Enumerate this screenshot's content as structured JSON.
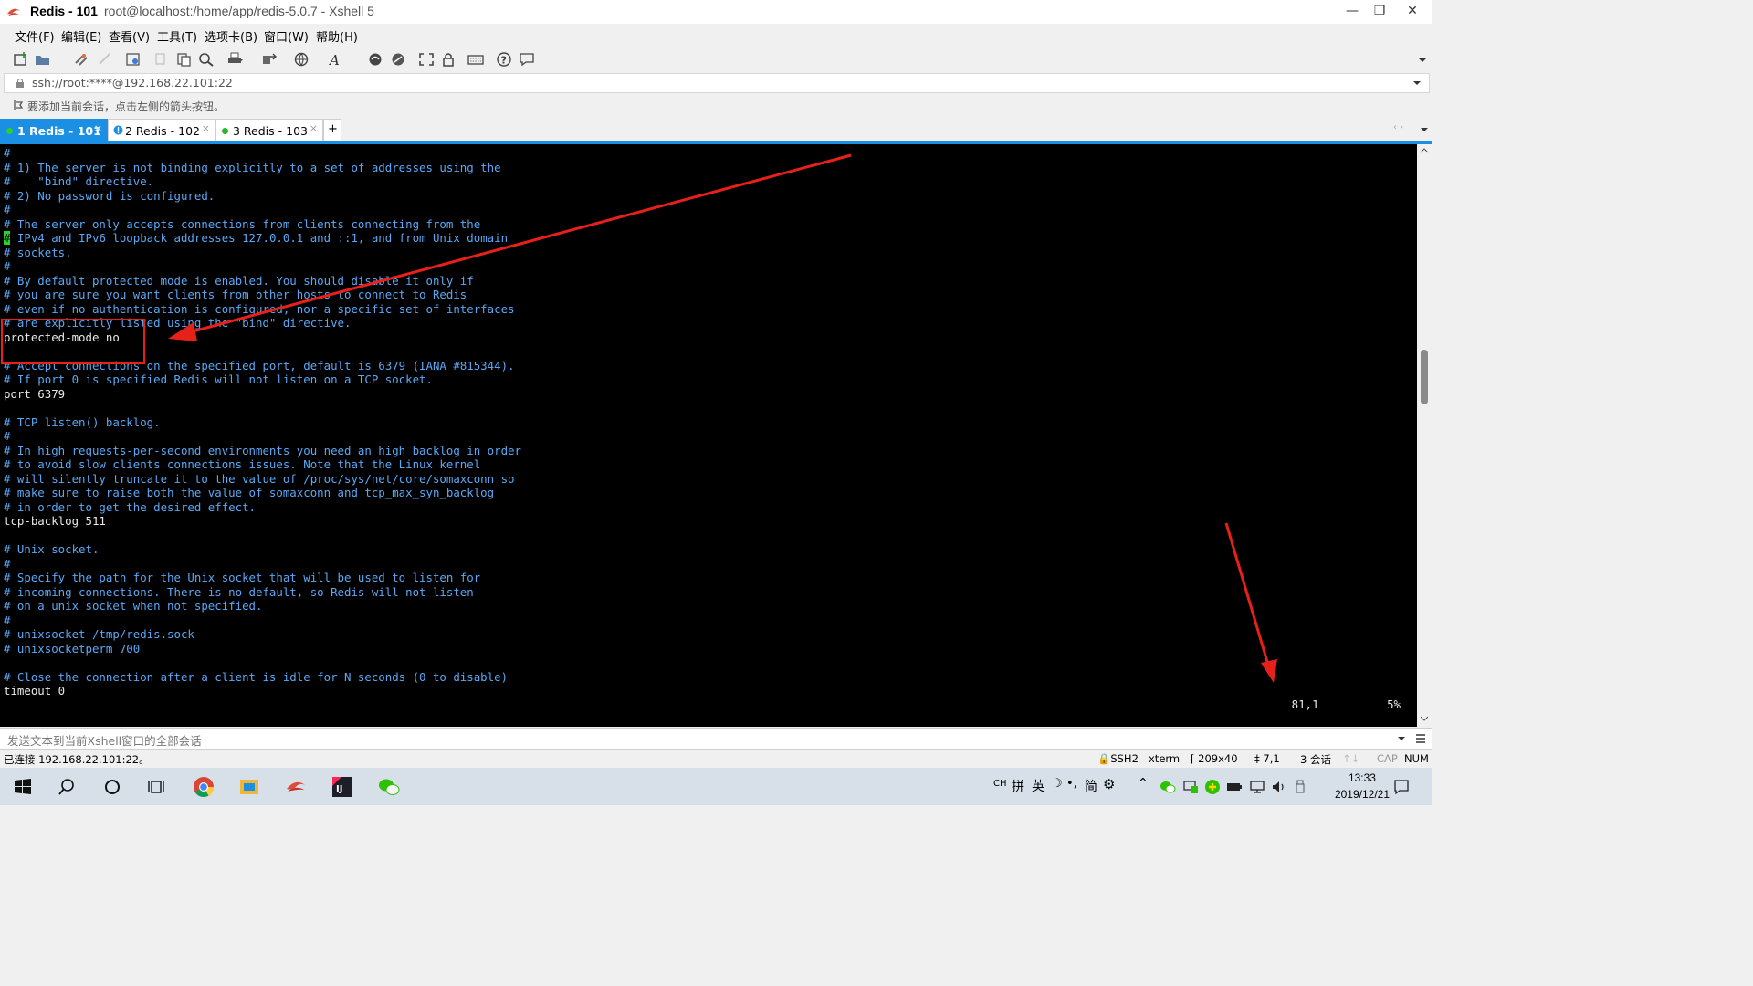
{
  "window": {
    "title": "Redis - 101",
    "subtitle": "root@localhost:/home/app/redis-5.0.7 - Xshell 5",
    "controls": {
      "minimize": "—",
      "restore": "❐",
      "close": "✕"
    }
  },
  "menu": [
    "文件(F)",
    "编辑(E)",
    "查看(V)",
    "工具(T)",
    "选项卡(B)",
    "窗口(W)",
    "帮助(H)"
  ],
  "address": "ssh://root:****@192.168.22.101:22",
  "hint": "要添加当前会话，点击左侧的箭头按钮。",
  "tabs": [
    {
      "label": "1 Redis - 101",
      "status_color": "#2bd12b",
      "active": true
    },
    {
      "label": "2 Redis - 102",
      "status_color": "#1a8fe3",
      "active": false
    },
    {
      "label": "3 Redis - 103",
      "status_color": "#2bb52b",
      "active": false
    }
  ],
  "tab_add": "+",
  "terminal": {
    "lines": [
      "#",
      "# 1) The server is not binding explicitly to a set of addresses using the",
      "#    \"bind\" directive.",
      "# 2) No password is configured.",
      "#",
      "# The server only accepts connections from clients connecting from the",
      "# IPv4 and IPv6 loopback addresses 127.0.0.1 and ::1, and from Unix domain",
      "# sockets.",
      "#",
      "# By default protected mode is enabled. You should disable it only if",
      "# you are sure you want clients from other hosts to connect to Redis",
      "# even if no authentication is configured, nor a specific set of interfaces",
      "# are explicitly listed using the \"bind\" directive.",
      "protected-mode no",
      "",
      "# Accept connections on the specified port, default is 6379 (IANA #815344).",
      "# If port 0 is specified Redis will not listen on a TCP socket.",
      "port 6379",
      "",
      "# TCP listen() backlog.",
      "#",
      "# In high requests-per-second environments you need an high backlog in order",
      "# to avoid slow clients connections issues. Note that the Linux kernel",
      "# will silently truncate it to the value of /proc/sys/net/core/somaxconn so",
      "# make sure to raise both the value of somaxconn and tcp_max_syn_backlog",
      "# in order to get the desired effect.",
      "tcp-backlog 511",
      "",
      "# Unix socket.",
      "#",
      "# Specify the path for the Unix socket that will be used to listen for",
      "# incoming connections. There is no default, so Redis will not listen",
      "# on a unix socket when not specified.",
      "#",
      "# unixsocket /tmp/redis.sock",
      "# unixsocketperm 700",
      "",
      "# Close the connection after a client is idle for N seconds (0 to disable)",
      "timeout 0"
    ],
    "cursor_line": 6,
    "position": "81,1",
    "percent": "5%"
  },
  "compose_placeholder": "发送文本到当前Xshell窗口的全部会话",
  "status": {
    "connected": "已连接 192.168.22.101:22。",
    "protocol": "SSH2",
    "term": "xterm",
    "size": "209x40",
    "cursor": "7,1",
    "sessions": "3 会话",
    "cap": "CAP",
    "num": "NUM"
  },
  "taskbar": {
    "time": "13:33",
    "date": "2019/12/21",
    "ime": [
      "CH",
      "拼",
      "英",
      "简"
    ]
  },
  "colors": {
    "accent": "#1a8fe3",
    "annotation": "#e8201a",
    "comment": "#5aa8f5"
  }
}
